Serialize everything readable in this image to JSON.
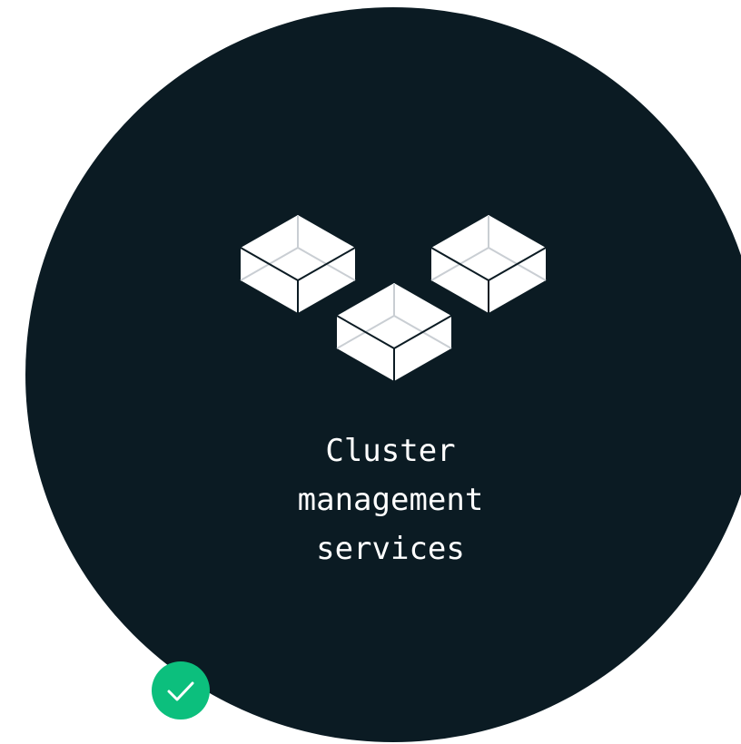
{
  "colors": {
    "circle": "#0b1b23",
    "background": "#ffffff",
    "cube_face": "#ffffff",
    "cube_edge_inner": "#c9ced3",
    "cube_edge_outer": "#0b1b23",
    "check_badge": "#0cbf7d",
    "check_mark": "#ffffff",
    "text": "#ffffff"
  },
  "icons": {
    "cubes": [
      "box-icon",
      "box-icon",
      "box-icon"
    ],
    "badge": "checkmark-icon"
  },
  "title": {
    "line1": "Cluster",
    "line2": "management",
    "line3": "services"
  }
}
